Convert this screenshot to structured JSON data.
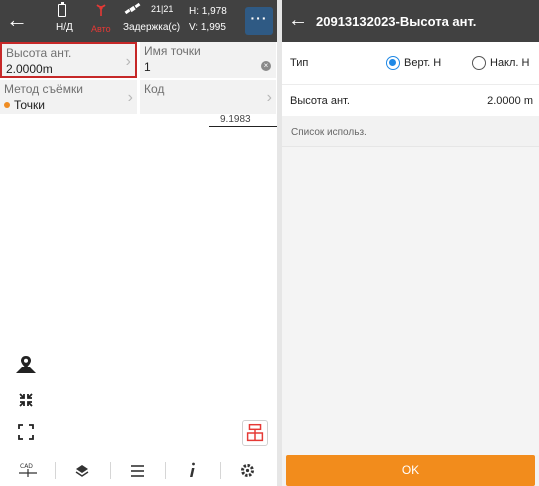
{
  "left": {
    "header": {
      "battery_text": "Н/Д",
      "mode_text": "Авто",
      "satellites_text": "21|21",
      "delay_text": "Задержка(с)",
      "h_text": "H: 1,978",
      "v_text": "V: 1,995",
      "more_label": "···",
      "mode_color": "#e53935"
    },
    "fields": {
      "antenna_height_label": "Высота ант.",
      "antenna_height_value": "2.0000m",
      "point_name_label": "Имя точки",
      "point_name_value": "1",
      "survey_method_label": "Метод съёмки",
      "survey_method_value": "Точки",
      "code_label": "Код",
      "code_value": ""
    },
    "map": {
      "scale_text": "9.1983"
    },
    "bottom_bar": [
      {
        "icon": "cad-icon"
      },
      {
        "icon": "layers-icon"
      },
      {
        "icon": "menu-icon"
      },
      {
        "icon": "info-icon"
      },
      {
        "icon": "settings-icon"
      }
    ],
    "highlight_color": "#c62828"
  },
  "right": {
    "title": "20913132023-Высота ант.",
    "type_label": "Тип",
    "options": {
      "vertical": "Верт. H",
      "inclined": "Накл. H",
      "selected": "vertical"
    },
    "antenna_height_label": "Высота ант.",
    "antenna_height_value": "2.0000 m",
    "list_label": "Список использ.",
    "ok_label": "OK",
    "accent_color": "#f28c1c",
    "radio_color": "#1e88e5"
  }
}
